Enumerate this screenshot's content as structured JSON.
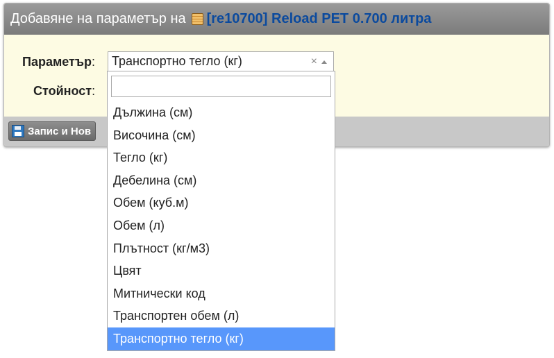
{
  "header": {
    "prefix": "Добавяне на параметър на",
    "product_link": "[re10700] Reload PET 0.700 литра"
  },
  "form": {
    "parameter_label": "Параметър",
    "value_label": "Стойност",
    "colon": ":",
    "selected_value": "Транспортно тегло (кг)",
    "clear_glyph": "×"
  },
  "footer": {
    "save_new_label": "Запис и Нов"
  },
  "dropdown": {
    "search_value": "",
    "options": [
      "Дължина (см)",
      "Височина (см)",
      "Тегло (кг)",
      "Дебелина (см)",
      "Обем (куб.м)",
      "Обем (л)",
      "Плътност (кг/м3)",
      "Цвят",
      "Митнически код",
      "Транспортен обем (л)",
      "Транспортно тегло (кг)"
    ],
    "highlighted_index": 10
  },
  "colors": {
    "header_bg": "#8a8a8a",
    "link": "#0b4a9e",
    "form_bg": "#fdfbe3",
    "highlight": "#5897fb"
  }
}
